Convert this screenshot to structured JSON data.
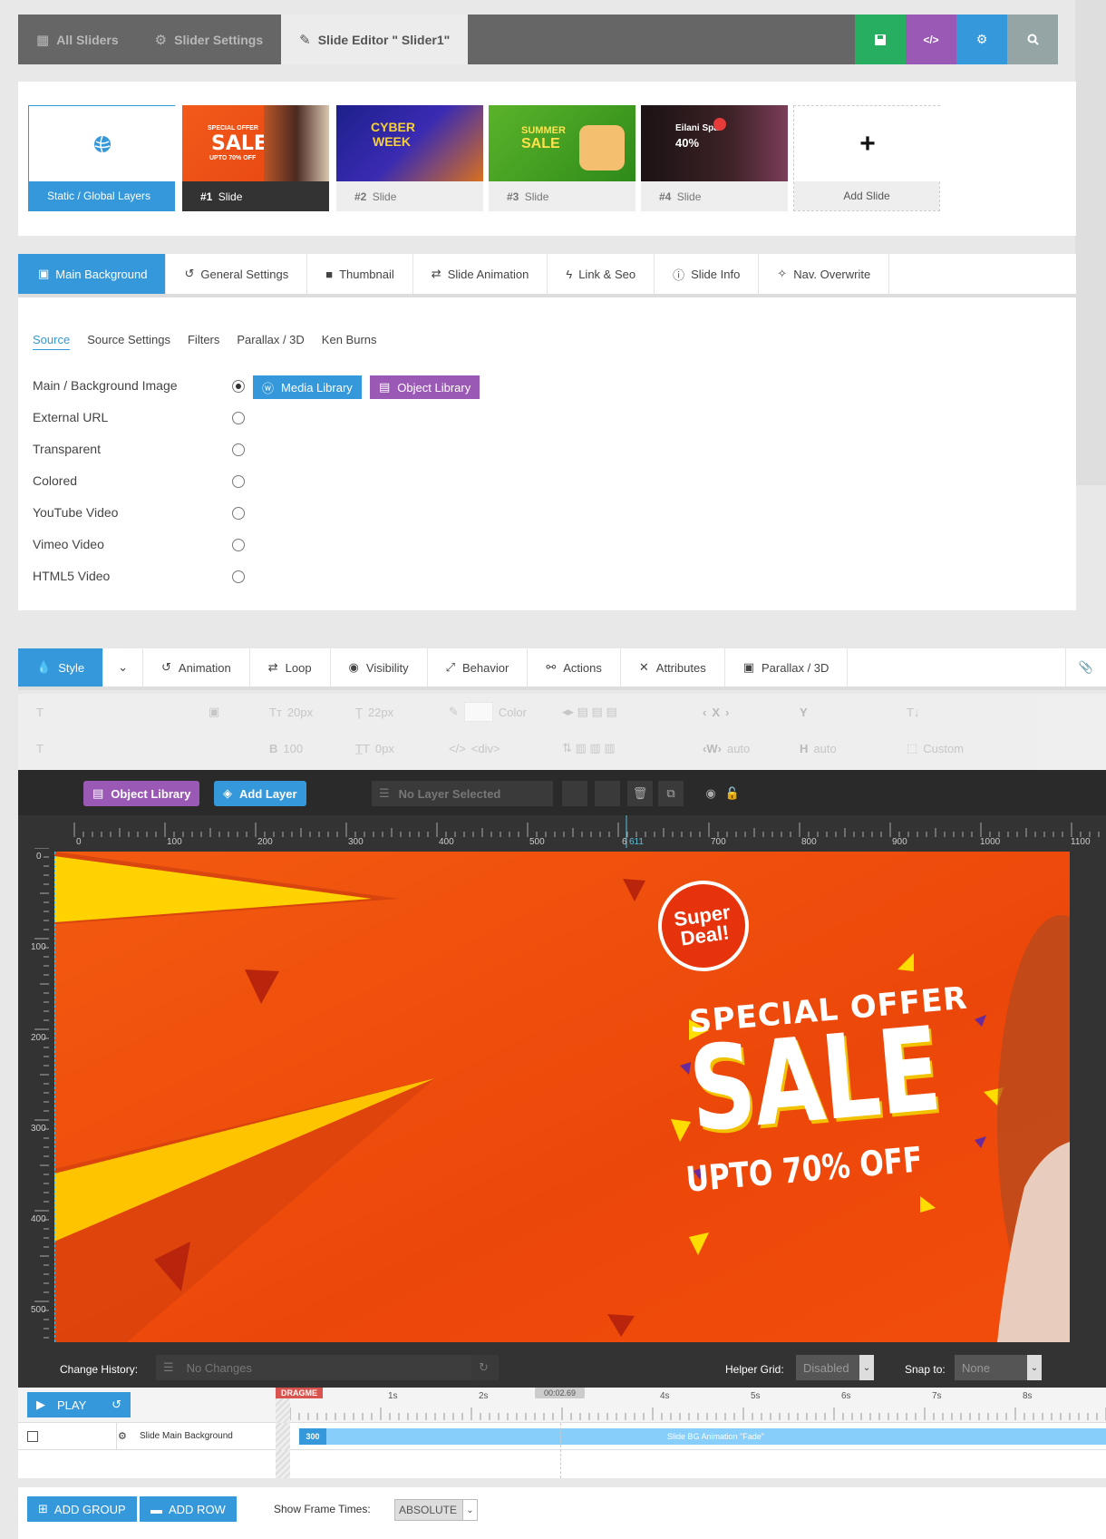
{
  "topnav": {
    "tabs": [
      {
        "label": "All Sliders",
        "icon": "grid-icon"
      },
      {
        "label": "Slider Settings",
        "icon": "gear-icon"
      },
      {
        "label": "Slide Editor \" Slider1\"",
        "icon": "pencil-icon"
      }
    ],
    "buttons": [
      {
        "name": "save-button",
        "icon": "save-icon",
        "color": "#27ae60"
      },
      {
        "name": "code-button",
        "icon": "code-icon",
        "glyph": "</>",
        "color": "#9b59b6"
      },
      {
        "name": "settings-button",
        "icon": "gear-icon",
        "color": "#3498db"
      },
      {
        "name": "preview-button",
        "icon": "search-icon",
        "color": "#95a5a6"
      }
    ]
  },
  "slides": {
    "static_label": "Static / Global Layers",
    "items": [
      {
        "num": "#1",
        "label": "Slide",
        "active": true
      },
      {
        "num": "#2",
        "label": "Slide"
      },
      {
        "num": "#3",
        "label": "Slide"
      },
      {
        "num": "#4",
        "label": "Slide"
      }
    ],
    "add_label": "Add Slide",
    "thumb_texts": {
      "t1_big": "SALE",
      "t1_small": "SPECIAL OFFER",
      "t1_sub": "UPTO 70% OFF",
      "t2_big": "CYBER",
      "t2_sub": "WEEK",
      "t3_big": "SUMMER",
      "t3_sub": "SALE",
      "t4_title": "Eilani Spa",
      "t4_pct": "40%"
    }
  },
  "main_tabs": [
    {
      "label": "Main Background",
      "icon": "image-icon",
      "active": true
    },
    {
      "label": "General Settings",
      "icon": "history-icon"
    },
    {
      "label": "Thumbnail",
      "icon": "thumbnail-icon"
    },
    {
      "label": "Slide Animation",
      "icon": "animation-icon"
    },
    {
      "label": "Link & Seo",
      "icon": "bolt-icon"
    },
    {
      "label": "Slide Info",
      "icon": "info-icon"
    },
    {
      "label": "Nav. Overwrite",
      "icon": "wand-icon"
    }
  ],
  "sub_tabs": [
    "Source",
    "Source Settings",
    "Filters",
    "Parallax / 3D",
    "Ken Burns"
  ],
  "sources": [
    {
      "label": "Main / Background Image",
      "selected": true
    },
    {
      "label": "External URL"
    },
    {
      "label": "Transparent"
    },
    {
      "label": "Colored"
    },
    {
      "label": "YouTube Video"
    },
    {
      "label": "Vimeo Video"
    },
    {
      "label": "HTML5 Video"
    }
  ],
  "library_buttons": {
    "media": "Media Library",
    "object": "Object Library"
  },
  "layer_tabs": [
    {
      "label": "Style",
      "icon": "drop-icon",
      "active": true
    },
    {
      "label": "",
      "icon": "chevron-down-icon"
    },
    {
      "label": "Animation",
      "icon": "history-icon"
    },
    {
      "label": "Loop",
      "icon": "loop-icon"
    },
    {
      "label": "Visibility",
      "icon": "eye-icon"
    },
    {
      "label": "Behavior",
      "icon": "expand-icon"
    },
    {
      "label": "Actions",
      "icon": "link-icon"
    },
    {
      "label": "Attributes",
      "icon": "tools-icon"
    },
    {
      "label": "Parallax / 3D",
      "icon": "image-icon"
    }
  ],
  "layer_tools": {
    "row1": {
      "font_size": "20px",
      "line_height": "22px",
      "color": "Color",
      "x": "X",
      "y": "Y"
    },
    "row2": {
      "weight": "100",
      "spacing": "0px",
      "tag": "<div>",
      "w": "W",
      "w_val": "auto",
      "h": "H",
      "h_val": "auto",
      "custom": "Custom"
    }
  },
  "editor": {
    "object_library": "Object Library",
    "add_layer": "Add Layer",
    "no_layer": "No Layer Selected",
    "ruler_top": [
      "0",
      "100",
      "200",
      "300",
      "400",
      "500",
      "6",
      "611",
      "700",
      "800",
      "900",
      "1000",
      "1100"
    ],
    "ruler_left": [
      "0",
      "100",
      "200",
      "300",
      "400",
      "500"
    ],
    "change_history_label": "Change History:",
    "no_changes": "No Changes",
    "helper_grid_label": "Helper Grid:",
    "helper_grid_value": "Disabled",
    "snap_label": "Snap to:",
    "snap_value": "None"
  },
  "canvas": {
    "badge_line1": "Super",
    "badge_line2": "Deal!",
    "special_offer": "SPECIAL OFFER",
    "sale": "SALE",
    "upto": "UPTO 70% OFF",
    "bg_color": "#ee4a0a"
  },
  "timeline": {
    "play": "PLAY",
    "dragme": "DRAGME",
    "time_marker": "00:02.69",
    "ticks": [
      "1s",
      "2s",
      "4s",
      "5s",
      "6s",
      "7s",
      "8s"
    ],
    "layer_name": "Slide Main Background",
    "bar_start": "300",
    "bar_label": "Slide BG Animation",
    "bar_anim": "\"Fade\""
  },
  "bottom": {
    "add_group": "ADD GROUP",
    "add_row": "ADD ROW",
    "frame_times_label": "Show Frame Times:",
    "frame_times_value": "ABSOLUTE"
  }
}
